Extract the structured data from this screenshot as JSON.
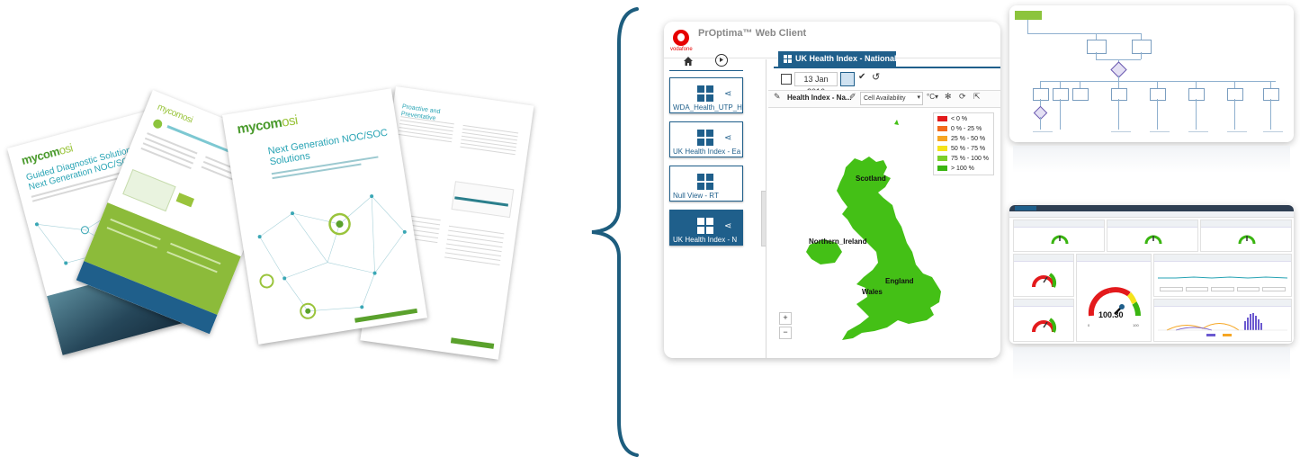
{
  "brochures": [
    {
      "brand_main": "mycom",
      "brand_accent": "osi",
      "title": "Guided Diagnostic Solutions for Next Generation NOC/SOCs"
    },
    {
      "brand_main": "mycom",
      "brand_accent": "osi",
      "title": ""
    },
    {
      "brand_main": "mycom",
      "brand_accent": "osi",
      "title": "Next Generation NOC/SOC Solutions"
    },
    {
      "heading": "Proactive and Preventative"
    }
  ],
  "webclient": {
    "app_title": "PrOptima™ Web Client",
    "vendor": "vodafone",
    "nav_tiles": [
      {
        "label": "WDA_Health_UTP_H",
        "active": false
      },
      {
        "label": "UK Health Index - Ea",
        "active": false
      },
      {
        "label": "Null View - RT",
        "active": false
      },
      {
        "label": "UK Health Index - N",
        "active": true
      }
    ],
    "tab_label": "UK Health Index - National",
    "date_value": "13 Jan 2016",
    "widget_title": "Health Index - Na...",
    "kpi_select": "Cell Availability",
    "legend": [
      {
        "label": "< 0 %",
        "color": "#e31a1c"
      },
      {
        "label": "0 % - 25 %",
        "color": "#f26b1d"
      },
      {
        "label": "25 % - 50 %",
        "color": "#f6a623"
      },
      {
        "label": "50 % - 75 %",
        "color": "#f4e31b"
      },
      {
        "label": "75 % - 100 %",
        "color": "#7bcf2a"
      },
      {
        "label": "> 100 %",
        "color": "#3ab511"
      }
    ],
    "regions": {
      "scotland": "Scotland",
      "northern_ireland": "Northern_Ireland",
      "england": "England",
      "wales": "Wales"
    },
    "zoom_in": "+",
    "zoom_out": "−"
  },
  "dashboard": {
    "big_gauge_value": "100.30",
    "big_gauge_min": "0",
    "big_gauge_max": "100"
  },
  "colors": {
    "teal": "#1d5d7e",
    "green": "#3ab511",
    "accent": "#27a3b4"
  }
}
